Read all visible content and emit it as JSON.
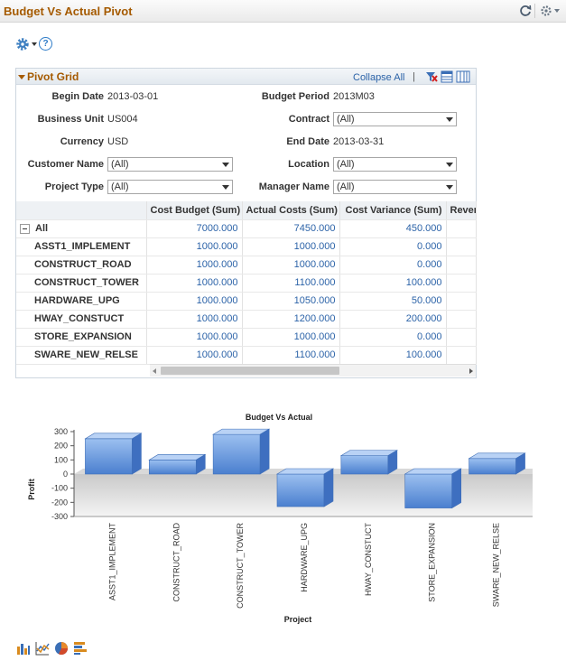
{
  "titlebar": {
    "title": "Budget Vs Actual Pivot"
  },
  "icons": {
    "refresh": "refresh-icon",
    "menu": "gear-menu-icon",
    "actions": "gear-icon",
    "help": "help-icon",
    "help_glyph": "?"
  },
  "pivot_grid": {
    "title": "Pivot Grid",
    "collapse_all": "Collapse All",
    "separator": "|",
    "fields": {
      "begin_date": {
        "label": "Begin Date",
        "value": "2013-03-01"
      },
      "budget_period": {
        "label": "Budget Period",
        "value": "2013M03"
      },
      "business_unit": {
        "label": "Business Unit",
        "value": "US004"
      },
      "contract": {
        "label": "Contract",
        "value": "(All)"
      },
      "currency": {
        "label": "Currency",
        "value": "USD"
      },
      "end_date": {
        "label": "End Date",
        "value": "2013-03-31"
      },
      "customer_name": {
        "label": "Customer Name",
        "value": "(All)"
      },
      "location": {
        "label": "Location",
        "value": "(All)"
      },
      "project_type": {
        "label": "Project Type",
        "value": "(All)"
      },
      "manager_name": {
        "label": "Manager Name",
        "value": "(All)"
      }
    },
    "columns": [
      "Cost Budget (Sum)",
      "Actual Costs (Sum)",
      "Cost Variance (Sum)",
      "Reven"
    ],
    "rows": [
      {
        "label": "All",
        "values": [
          "7000.000",
          "7450.000",
          "450.000",
          ""
        ]
      },
      {
        "label": "ASST1_IMPLEMENT",
        "values": [
          "1000.000",
          "1000.000",
          "0.000",
          ""
        ]
      },
      {
        "label": "CONSTRUCT_ROAD",
        "values": [
          "1000.000",
          "1000.000",
          "0.000",
          ""
        ]
      },
      {
        "label": "CONSTRUCT_TOWER",
        "values": [
          "1000.000",
          "1100.000",
          "100.000",
          ""
        ]
      },
      {
        "label": "HARDWARE_UPG",
        "values": [
          "1000.000",
          "1050.000",
          "50.000",
          ""
        ]
      },
      {
        "label": "HWAY_CONSTUCT",
        "values": [
          "1000.000",
          "1200.000",
          "200.000",
          ""
        ]
      },
      {
        "label": "STORE_EXPANSION",
        "values": [
          "1000.000",
          "1000.000",
          "0.000",
          ""
        ]
      },
      {
        "label": "SWARE_NEW_RELSE",
        "values": [
          "1000.000",
          "1100.000",
          "100.000",
          ""
        ]
      }
    ],
    "scroll_position": 0.0
  },
  "chart_data": {
    "type": "bar",
    "title": "Budget Vs Actual",
    "xlabel": "Project",
    "ylabel": "Profit",
    "categories": [
      "ASST1_IMPLEMENT",
      "CONSTRUCT_ROAD",
      "CONSTRUCT_TOWER",
      "HARDWARE_UPG",
      "HWAY_CONSTUCT",
      "STORE_EXPANSION",
      "SWARE_NEW_RELSE"
    ],
    "values": [
      250,
      100,
      280,
      -230,
      130,
      -240,
      110
    ],
    "ylim": [
      -300,
      300
    ],
    "yticks": [
      "300",
      "200",
      "100",
      "0",
      "-100",
      "-200",
      "-300"
    ],
    "bar_color": "#5b8fd9",
    "three_d": true
  },
  "chart_types": [
    "bar-chart-icon",
    "line-chart-icon",
    "pie-chart-icon",
    "horizontal-bar-chart-icon"
  ]
}
